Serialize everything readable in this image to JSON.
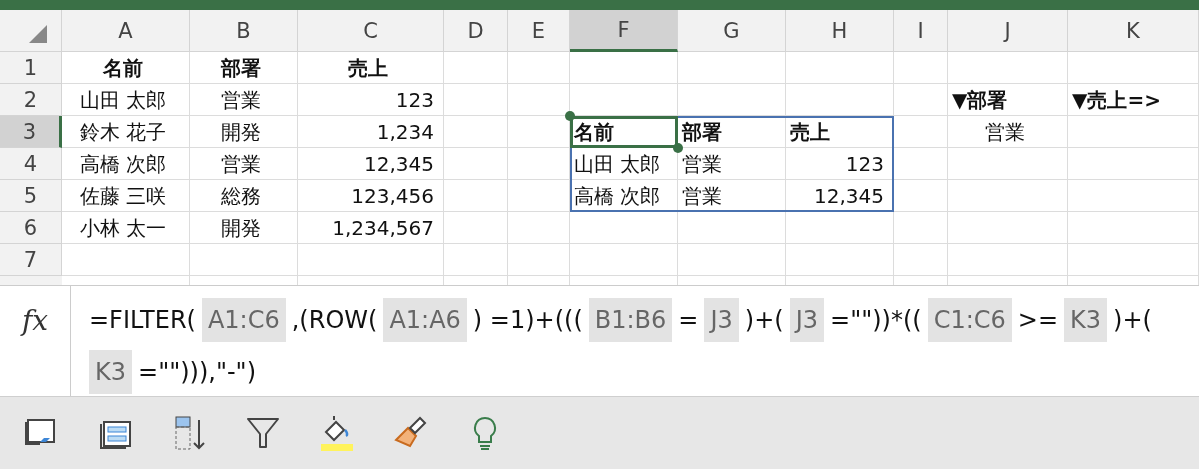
{
  "columns": [
    {
      "label": "A",
      "selected": false
    },
    {
      "label": "B",
      "selected": false
    },
    {
      "label": "C",
      "selected": false
    },
    {
      "label": "D",
      "selected": false
    },
    {
      "label": "E",
      "selected": false
    },
    {
      "label": "F",
      "selected": true
    },
    {
      "label": "G",
      "selected": false
    },
    {
      "label": "H",
      "selected": false
    },
    {
      "label": "I",
      "selected": false
    },
    {
      "label": "J",
      "selected": false
    },
    {
      "label": "K",
      "selected": false
    }
  ],
  "rows": [
    {
      "label": "1",
      "selected": false,
      "cells": {
        "A": {
          "text": "名前",
          "bold": true,
          "kind": "centered"
        },
        "B": {
          "text": "部署",
          "bold": true,
          "kind": "centered"
        },
        "C": {
          "text": "売上",
          "bold": true,
          "kind": "centered"
        }
      }
    },
    {
      "label": "2",
      "selected": false,
      "cells": {
        "A": {
          "text": "山田 太郎",
          "bold": false,
          "kind": "centered"
        },
        "B": {
          "text": "営業",
          "bold": false,
          "kind": "centered"
        },
        "C": {
          "text": "123",
          "bold": false,
          "kind": "number"
        },
        "J": {
          "text": "▼部署",
          "bold": true,
          "kind": "plain"
        },
        "K": {
          "text": "▼売上=>",
          "bold": true,
          "kind": "plain"
        }
      }
    },
    {
      "label": "3",
      "selected": true,
      "cells": {
        "A": {
          "text": "鈴木 花子",
          "bold": false,
          "kind": "centered"
        },
        "B": {
          "text": "開発",
          "bold": false,
          "kind": "centered"
        },
        "C": {
          "text": "1,234",
          "bold": false,
          "kind": "number"
        },
        "F": {
          "text": "名前",
          "bold": true,
          "kind": "plain",
          "spill": true,
          "selected": true
        },
        "G": {
          "text": "部署",
          "bold": true,
          "kind": "plain",
          "spill": true
        },
        "H": {
          "text": "売上",
          "bold": true,
          "kind": "plain",
          "spill": true
        },
        "J": {
          "text": "営業",
          "bold": false,
          "kind": "centered"
        }
      }
    },
    {
      "label": "4",
      "selected": false,
      "cells": {
        "A": {
          "text": "高橋 次郎",
          "bold": false,
          "kind": "centered"
        },
        "B": {
          "text": "営業",
          "bold": false,
          "kind": "centered"
        },
        "C": {
          "text": "12,345",
          "bold": false,
          "kind": "number"
        },
        "F": {
          "text": "山田 太郎",
          "bold": false,
          "kind": "plain",
          "spill": true
        },
        "G": {
          "text": "営業",
          "bold": false,
          "kind": "plain"
        },
        "H": {
          "text": "123",
          "bold": false,
          "kind": "number",
          "spill": true
        }
      }
    },
    {
      "label": "5",
      "selected": false,
      "cells": {
        "A": {
          "text": "佐藤 三咲",
          "bold": false,
          "kind": "centered"
        },
        "B": {
          "text": "総務",
          "bold": false,
          "kind": "centered"
        },
        "C": {
          "text": "123,456",
          "bold": false,
          "kind": "number"
        },
        "F": {
          "text": "高橋 次郎",
          "bold": false,
          "kind": "plain",
          "spill": true
        },
        "G": {
          "text": "営業",
          "bold": false,
          "kind": "plain",
          "spill": true
        },
        "H": {
          "text": "12,345",
          "bold": false,
          "kind": "number",
          "spill": true
        }
      }
    },
    {
      "label": "6",
      "selected": false,
      "cells": {
        "A": {
          "text": "小林 太一",
          "bold": false,
          "kind": "centered"
        },
        "B": {
          "text": "開発",
          "bold": false,
          "kind": "centered"
        },
        "C": {
          "text": "1,234,567",
          "bold": false,
          "kind": "number"
        }
      }
    },
    {
      "label": "7",
      "selected": false,
      "cells": {}
    }
  ],
  "formula_bar": {
    "icon": "fx",
    "lines": [
      [
        {
          "text": "=FILTER(",
          "kind": "plain"
        },
        {
          "text": "A1:C6",
          "kind": "ref"
        },
        {
          "text": ",(ROW(",
          "kind": "plain"
        },
        {
          "text": "A1:A6",
          "kind": "ref"
        },
        {
          "text": ") =1)+(((",
          "kind": "plain"
        },
        {
          "text": "B1:B6",
          "kind": "ref"
        },
        {
          "text": "=",
          "kind": "plain"
        },
        {
          "text": "J3",
          "kind": "ref"
        },
        {
          "text": ")+(",
          "kind": "plain"
        },
        {
          "text": "J3",
          "kind": "ref"
        },
        {
          "text": "=\"\"))*((",
          "kind": "plain"
        },
        {
          "text": "C1:C6",
          "kind": "ref"
        },
        {
          "text": ">=",
          "kind": "plain"
        },
        {
          "text": "K3",
          "kind": "ref"
        },
        {
          "text": ")+(",
          "kind": "plain"
        }
      ],
      [
        {
          "text": "K3",
          "kind": "ref"
        },
        {
          "text": "=\"\"))),\"-\")",
          "kind": "plain"
        }
      ]
    ]
  },
  "toolbar": [
    {
      "kind": "window"
    },
    {
      "kind": "layout"
    },
    {
      "kind": "sort"
    },
    {
      "kind": "filter"
    },
    {
      "kind": "fill"
    },
    {
      "kind": "brush"
    },
    {
      "kind": "bulb"
    }
  ]
}
